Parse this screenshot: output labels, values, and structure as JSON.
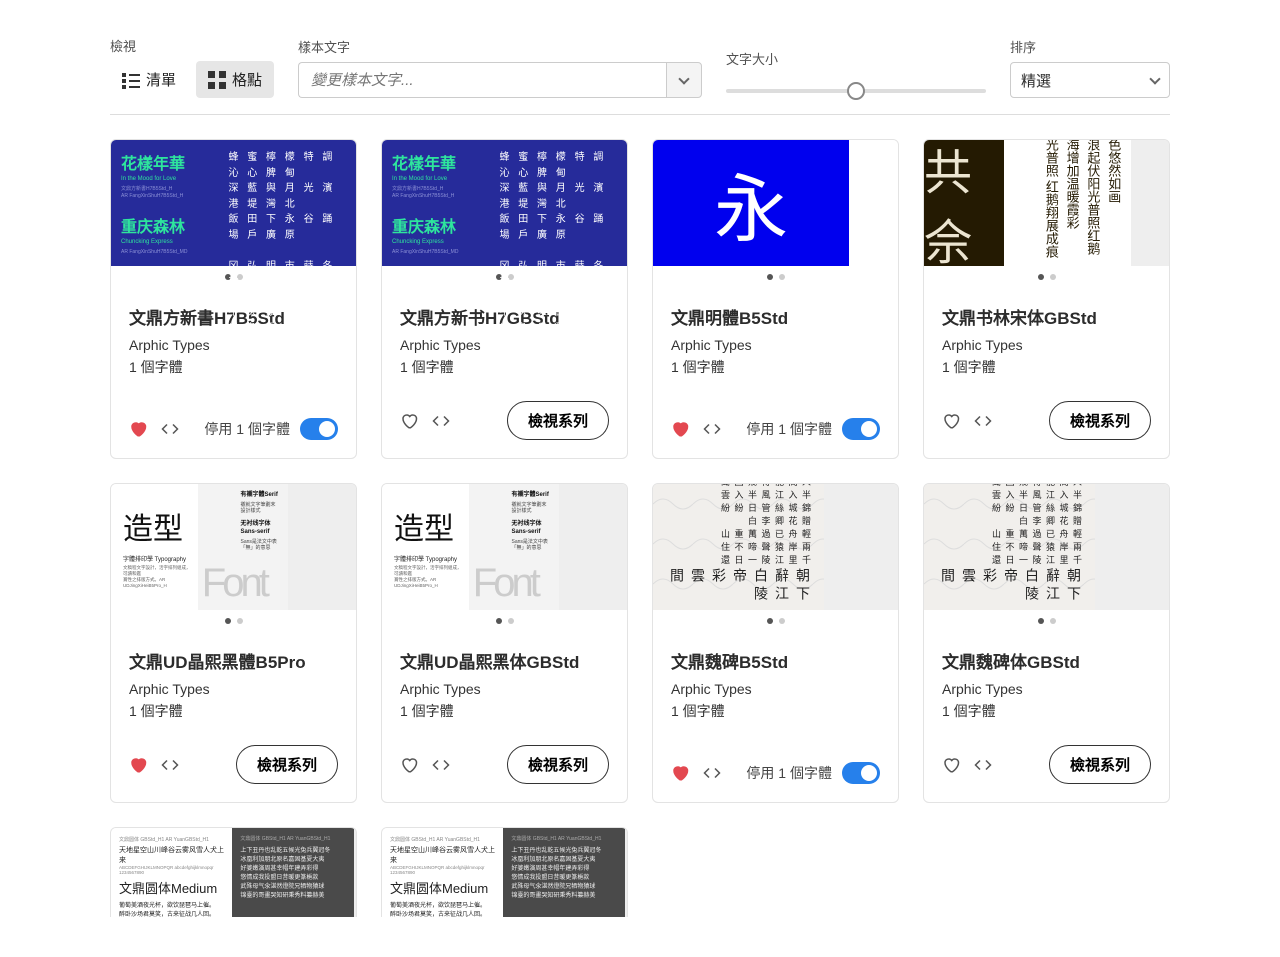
{
  "toolbar": {
    "view_label": "檢視",
    "list_label": "清單",
    "grid_label": "格點",
    "sample_label": "樣本文字",
    "sample_placeholder": "變更樣本文字...",
    "size_label": "文字大小",
    "sort_label": "排序",
    "sort_value": "精選"
  },
  "actions": {
    "view_family": "檢視系列",
    "deactivate_one": "停用 1 個字體"
  },
  "cards": [
    {
      "name": "文鼎方新書H7B5Std",
      "foundry": "Arphic Types",
      "count": "1 個字體",
      "liked": true,
      "mode": "deactivate",
      "preview": "blue"
    },
    {
      "name": "文鼎方新书H7GBStd",
      "foundry": "Arphic Types",
      "count": "1 個字體",
      "liked": false,
      "mode": "view",
      "preview": "blue"
    },
    {
      "name": "文鼎明體B5Std",
      "foundry": "Arphic Types",
      "count": "1 個字體",
      "liked": true,
      "mode": "deactivate",
      "preview": "ming"
    },
    {
      "name": "文鼎书林宋体GBStd",
      "foundry": "Arphic Types",
      "count": "1 個字體",
      "liked": false,
      "mode": "view",
      "preview": "shulin"
    },
    {
      "name": "文鼎UD晶熙黑體B5Pro",
      "foundry": "Arphic Types",
      "count": "1 個字體",
      "liked": true,
      "mode": "view",
      "preview": "jingxi"
    },
    {
      "name": "文鼎UD晶熙黑体GBStd",
      "foundry": "Arphic Types",
      "count": "1 個字體",
      "liked": false,
      "mode": "view",
      "preview": "jingxi"
    },
    {
      "name": "文鼎魏碑B5Std",
      "foundry": "Arphic Types",
      "count": "1 個字體",
      "liked": true,
      "mode": "deactivate",
      "preview": "wei"
    },
    {
      "name": "文鼎魏碑体GBStd",
      "foundry": "Arphic Types",
      "count": "1 個字體",
      "liked": false,
      "mode": "view",
      "preview": "wei"
    },
    {
      "name": "",
      "foundry": "",
      "count": "",
      "liked": false,
      "mode": "none",
      "preview": "yuan"
    },
    {
      "name": "",
      "foundry": "",
      "count": "",
      "liked": false,
      "mode": "none",
      "preview": "yuan"
    }
  ],
  "preview_text": {
    "blue_title1": "花樣年華",
    "blue_sub1": "In the Mood for Love",
    "blue_title2": "重庆森林",
    "blue_sub2": "Chuncking Express",
    "blue_right": "蜂 蜜 檸 檬 特 調 沁 心 脾 甸\n深 藍 與 月 光 濱 港 堤 灣 北\n飯 田 下 永 谷 踊 場 戶 廣 原\n\n冈 弘 明 市 蒔 冬 桥 伊 嘉 佐\n內 櫻 卉 町 高 南 中 央 家 固\n光 兔 兵 翼 冠 冬 冰 凰 利 夏",
    "ming_big": "永",
    "shulin_text": "景色悠然如画\n柳浪起伏阳光普照红鹅\n烟海增加温暖霞彩\n昭光普照 红鹅翔展成痕",
    "wei_title": "下江陵",
    "wei_lines": "朝辭白帝彩雲間\n千里江陵一日還\n兩岸猿聲啼不住\n輕舟已過萬重山\n贈花卿 李白\n錦城絲管日紛紛\n半入江風半入雲\n人間能得幾回聞",
    "yuan_name": "文鼎圆体Medium",
    "yuan_left": "天地星空山川峰谷云雾风雪人犬上来\nABCDEFGHIJKLMNOPQR   abcdefghijklmnopqr   1234567890\n\n葡萄美酒夜光杯，欲饮琵琶马上催。\n醉卧沙场君莫笑，古来征战几人回。\n锦臺的哥畫哭知研秉秀料纂赫美",
    "yuan_right": "上下丑丹也乱乾五候光兔兵翼冠冬\n冰凰利加朋北原名嘉固基夏大夷\n好婆嫩演周甚幸帽年建弄彩得\n悠情成我投盟日昔暖更篆梔款\n武殊母气氽湛然燈院兄牺物猿球\n锦臺的哥畫哭知研秉秀料纂赫美"
  }
}
